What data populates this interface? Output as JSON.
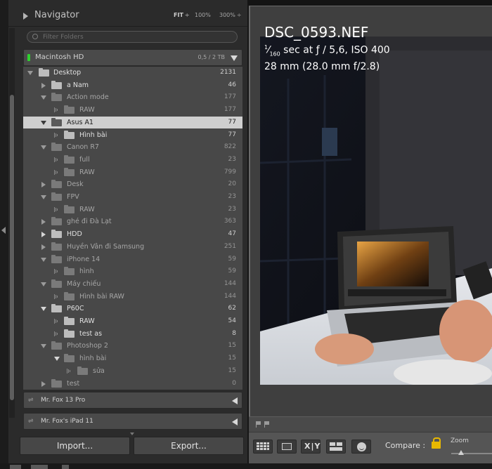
{
  "navigator": {
    "title": "Navigator",
    "zoom_fit": "FIT",
    "zoom_100": "100%",
    "zoom_300": "300%"
  },
  "filter": {
    "placeholder": "Filter Folders"
  },
  "volume": {
    "name": "Macintosh HD",
    "size": "0,5 / 2 TB"
  },
  "folders": [
    {
      "name": "Desktop",
      "count": "2131"
    },
    {
      "name": "a Nam",
      "count": "46"
    },
    {
      "name": "Action mode",
      "count": "177"
    },
    {
      "name": "RAW",
      "count": "177"
    },
    {
      "name": "Asus A1",
      "count": "77"
    },
    {
      "name": "Hình bài",
      "count": "77"
    },
    {
      "name": "Canon R7",
      "count": "822"
    },
    {
      "name": "full",
      "count": "23"
    },
    {
      "name": "RAW",
      "count": "799"
    },
    {
      "name": "Desk",
      "count": "20"
    },
    {
      "name": "FPV",
      "count": "23"
    },
    {
      "name": "RAW",
      "count": "23"
    },
    {
      "name": "ghé đi Đà Lạt",
      "count": "363"
    },
    {
      "name": "HDD",
      "count": "47"
    },
    {
      "name": "Huyền Vân đi Samsung",
      "count": "251"
    },
    {
      "name": "iPhone 14",
      "count": "59"
    },
    {
      "name": "hình",
      "count": "59"
    },
    {
      "name": "Máy chiếu",
      "count": "144"
    },
    {
      "name": "Hình bài RAW",
      "count": "144"
    },
    {
      "name": "P60C",
      "count": "62"
    },
    {
      "name": "RAW",
      "count": "54"
    },
    {
      "name": "test as",
      "count": "8"
    },
    {
      "name": "Photoshop 2",
      "count": "15"
    },
    {
      "name": "hình bài",
      "count": "15"
    },
    {
      "name": "sửa",
      "count": "15"
    },
    {
      "name": "test",
      "count": "0"
    }
  ],
  "devices": [
    {
      "name": "Mr. Fox 13 Pro"
    },
    {
      "name": "Mr. Fox's iPad 11"
    }
  ],
  "buttons": {
    "import": "Import...",
    "export": "Export..."
  },
  "photo_info": {
    "filename": "DSC_0593.NEF",
    "shutter_numerator": "1",
    "shutter_denominator": "160",
    "exposure_rest": " sec at ƒ / 5,6, ISO 400",
    "lens": "28 mm (28.0 mm f/2.8)"
  },
  "toolbar": {
    "compare_label": "Compare :",
    "zoom_label": "Zoom"
  },
  "colors": {
    "panel": "#2b2b2b",
    "tree_bg": "#484848",
    "selected_row": "#cfcfcf",
    "drive_led": "#2fd12f",
    "lock": "#e8b800"
  }
}
